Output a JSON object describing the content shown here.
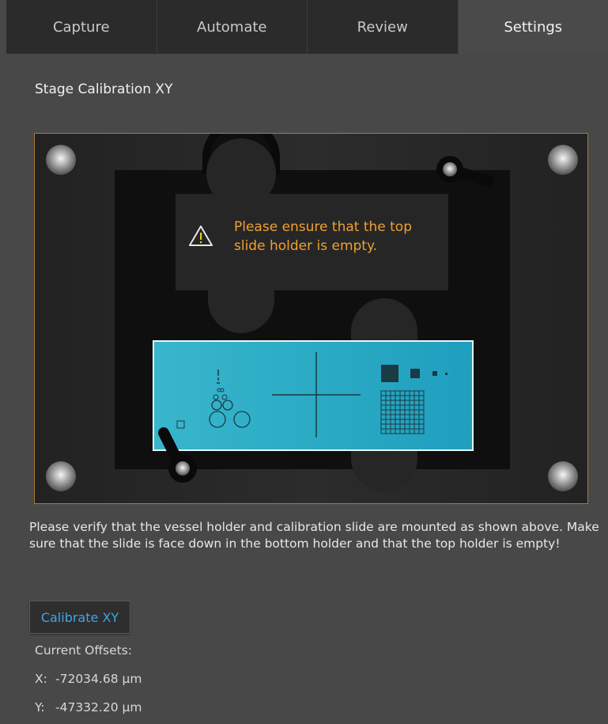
{
  "tabs": [
    {
      "label": "Capture",
      "active": false
    },
    {
      "label": "Automate",
      "active": false
    },
    {
      "label": "Review",
      "active": false
    },
    {
      "label": "Settings",
      "active": true
    }
  ],
  "section": {
    "title": "Stage Calibration XY"
  },
  "illustration": {
    "warning_icon": "warning-triangle-icon",
    "warning_text": "Please ensure that the top slide holder is empty."
  },
  "instructions": "Please verify that the vessel holder and calibration slide are mounted as shown above. Make sure that the slide is face down in the bottom holder and that the top holder is empty!",
  "calibrate_button": {
    "label": "Calibrate XY"
  },
  "offsets": {
    "label": "Current Offsets:",
    "x": {
      "axis": "X:",
      "value": "-72034.68 µm"
    },
    "y": {
      "axis": "Y:",
      "value": "-47332.20 µm"
    }
  },
  "colors": {
    "accent": "#3ea6e8",
    "warning": "#f0a030",
    "frame_border": "#b07a2a",
    "slide": "#2aa8c4"
  }
}
